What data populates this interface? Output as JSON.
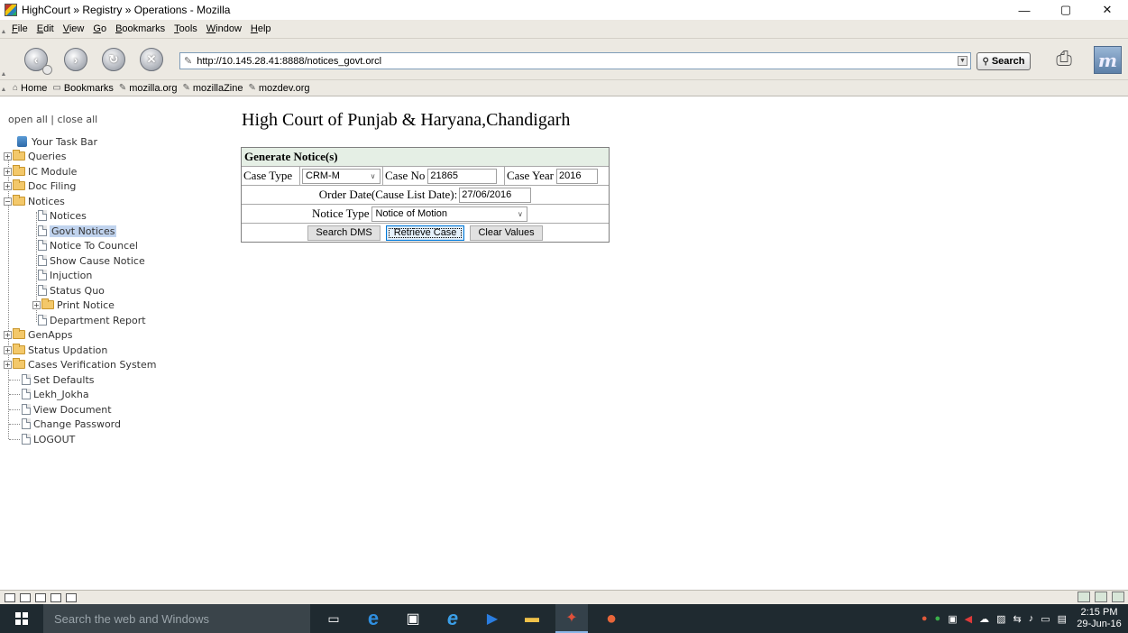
{
  "window": {
    "title": "HighCourt » Registry » Operations - Mozilla",
    "controls": {
      "minimize": "—",
      "maximize": "▢",
      "close": "✕"
    }
  },
  "menu": [
    "File",
    "Edit",
    "View",
    "Go",
    "Bookmarks",
    "Tools",
    "Window",
    "Help"
  ],
  "navbar": {
    "url": "http://10.145.28.41:8888/notices_govt.orcl",
    "search_label": "Search",
    "icons": [
      "back-icon",
      "forward-icon",
      "reload-icon",
      "stop-icon"
    ]
  },
  "personal_toolbar": [
    {
      "label": "Home",
      "icon": "home-icon"
    },
    {
      "label": "Bookmarks",
      "icon": "bookmarks-folder-icon"
    },
    {
      "label": "mozilla.org",
      "icon": "link-icon"
    },
    {
      "label": "mozillaZine",
      "icon": "link-icon"
    },
    {
      "label": "mozdev.org",
      "icon": "link-icon"
    }
  ],
  "tree": {
    "open_close": "open all | close all",
    "root": "Your Task Bar",
    "items": [
      "Queries",
      "IC Module",
      "Doc Filing",
      "Notices",
      "Notices",
      "Govt Notices",
      "Notice To Councel",
      "Show Cause Notice",
      "Injuction",
      "Status Quo",
      "Print Notice",
      "Department Report",
      "GenApps",
      "Status Updation",
      "Cases Verification System",
      "Set Defaults",
      "Lekh_Jokha",
      "View Document",
      "Change Password",
      "LOGOUT"
    ],
    "selected": "Govt Notices"
  },
  "main": {
    "heading": "High Court of Punjab & Haryana,Chandigarh",
    "form": {
      "title": "Generate Notice(s)",
      "case_type_label": "Case Type",
      "case_type_value": "CRM-M",
      "case_no_label": "Case No",
      "case_no_value": "21865",
      "case_year_label": "Case Year",
      "case_year_value": "2016",
      "order_date_label": "Order Date(Cause List Date):",
      "order_date_value": "27/06/2016",
      "notice_type_label": "Notice Type",
      "notice_type_value": "Notice of Motion",
      "buttons": {
        "search_dms": "Search DMS",
        "retrieve_case": "Retrieve Case",
        "clear_values": "Clear Values"
      }
    }
  },
  "taskbar": {
    "search_placeholder": "Search the web and Windows",
    "clock_time": "2:15 PM",
    "clock_date": "29-Jun-16"
  }
}
